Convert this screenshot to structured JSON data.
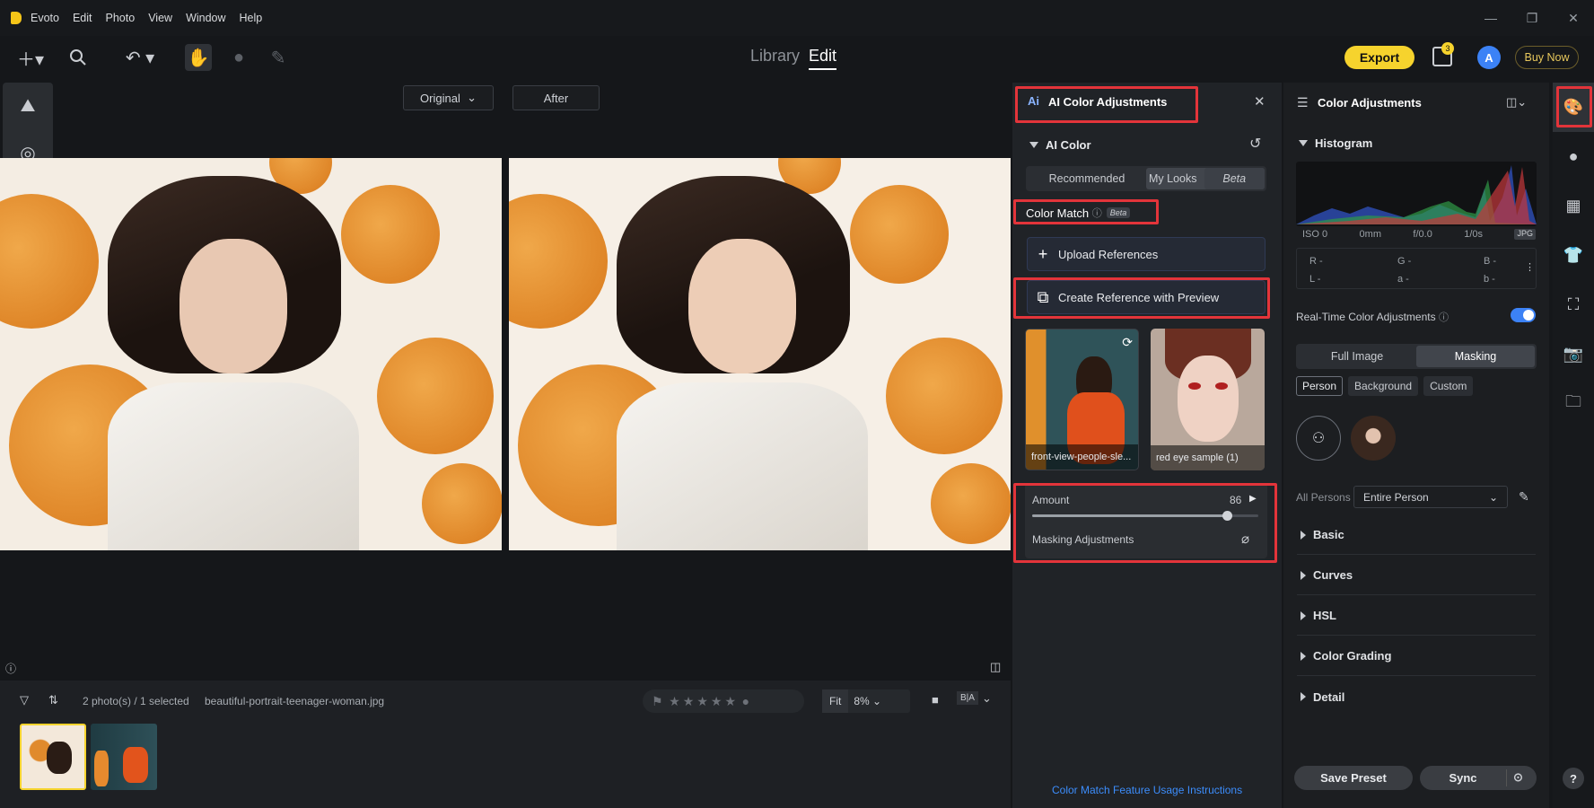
{
  "menu": {
    "app": "Evoto",
    "items": [
      "Edit",
      "Photo",
      "View",
      "Window",
      "Help"
    ]
  },
  "modes": {
    "library": "Library",
    "edit": "Edit"
  },
  "header": {
    "export": "Export",
    "buy_now": "Buy Now",
    "avatar_letter": "A",
    "notif_count": "3"
  },
  "compare": {
    "original": "Original",
    "after": "After"
  },
  "ai_panel": {
    "title": "AI Color Adjustments",
    "ai_color": "AI Color",
    "tabs": [
      "Recommended",
      "My Looks"
    ],
    "my_looks_badge": "Beta",
    "color_match": "Color Match",
    "color_match_badge": "Beta",
    "upload": "Upload References",
    "create": "Create Reference with Preview",
    "refs": [
      {
        "caption": "front-view-people-sle..."
      },
      {
        "caption": "red eye sample (1)"
      }
    ],
    "amount_label": "Amount",
    "amount_value": "86",
    "amount_fraction": 0.86,
    "masking": "Masking Adjustments",
    "usage_link": "Color Match Feature Usage Instructions"
  },
  "right_panel": {
    "title": "Color Adjustments",
    "histogram": "Histogram",
    "exif": {
      "iso": "ISO 0",
      "focal": "0mm",
      "aperture": "f/0.0",
      "shutter": "1/0s",
      "format": "JPG"
    },
    "rgb": {
      "r": "R -",
      "g": "G -",
      "b": "B -",
      "l": "L -",
      "a": "a -",
      "b2": "b -"
    },
    "realtime": "Real-Time Color Adjustments",
    "realtime_on": true,
    "mode_tabs": [
      "Full Image",
      "Masking"
    ],
    "mask_tabs": [
      "Person",
      "Background",
      "Custom"
    ],
    "persons_label": "All Persons",
    "persons_select": "Entire Person",
    "sections": [
      "Basic",
      "Curves",
      "HSL",
      "Color Grading",
      "Detail"
    ],
    "save_preset": "Save Preset",
    "sync": "Sync"
  },
  "filmstrip": {
    "count": "2 photo(s) / 1 selected",
    "filename": "beautiful-portrait-teenager-woman.jpg",
    "fit": "Fit",
    "zoom": "8%"
  },
  "colors": {
    "accent": "#f6d32d",
    "highlight": "#e3343a",
    "toggle": "#3c82f6"
  }
}
